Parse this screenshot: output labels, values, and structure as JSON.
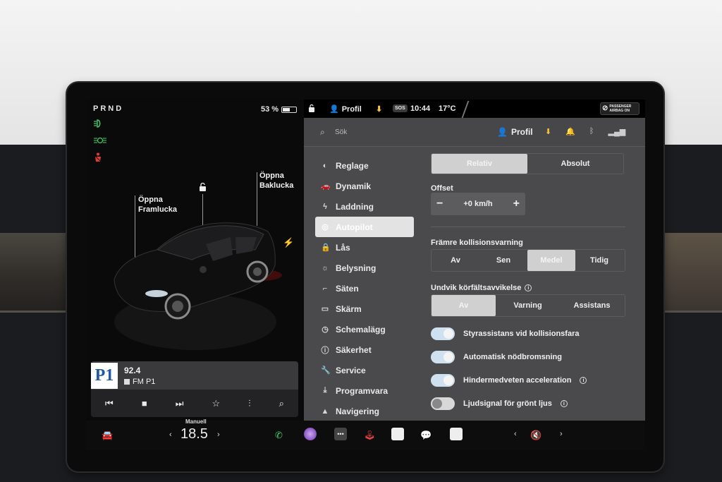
{
  "status": {
    "gear": "PRND",
    "battery_pct": "53 %",
    "battery_level": 0.53,
    "profile": "Profil",
    "time": "10:44",
    "temperature": "17°C",
    "sos": "SOS",
    "airbag_line1": "PASSENGER",
    "airbag_line2": "AIRBAG ON"
  },
  "car": {
    "front_trunk_line1": "Öppna",
    "front_trunk_line2": "Framlucka",
    "rear_trunk_line1": "Öppna",
    "rear_trunk_line2": "Baklucka"
  },
  "media": {
    "logo": "P1",
    "frequency": "92.4",
    "source": "FM P1"
  },
  "settings_header": {
    "search_placeholder": "Sök",
    "profile": "Profil"
  },
  "menu": [
    {
      "label": "Reglage",
      "icon": "toggle-icon"
    },
    {
      "label": "Dynamik",
      "icon": "car-icon"
    },
    {
      "label": "Laddning",
      "icon": "bolt-icon"
    },
    {
      "label": "Autopilot",
      "icon": "steering-wheel-icon",
      "active": true
    },
    {
      "label": "Lås",
      "icon": "lock-icon"
    },
    {
      "label": "Belysning",
      "icon": "sun-icon"
    },
    {
      "label": "Säten",
      "icon": "seat-icon"
    },
    {
      "label": "Skärm",
      "icon": "display-icon"
    },
    {
      "label": "Schemalägg",
      "icon": "clock-icon"
    },
    {
      "label": "Säkerhet",
      "icon": "info-icon"
    },
    {
      "label": "Service",
      "icon": "wrench-icon"
    },
    {
      "label": "Programvara",
      "icon": "download-icon"
    },
    {
      "label": "Navigering",
      "icon": "navigation-icon"
    }
  ],
  "autopilot": {
    "speed_mode": {
      "options": [
        "Relativ",
        "Absolut"
      ],
      "selected": "Relativ"
    },
    "offset_label": "Offset",
    "offset_value": "+0 km/h",
    "minus": "−",
    "plus": "+",
    "fcw_label": "Främre kollisionsvarning",
    "fcw": {
      "options": [
        "Av",
        "Sen",
        "Medel",
        "Tidig"
      ],
      "selected": "Medel"
    },
    "lane_label": "Undvik körfältsavvikelse",
    "lane": {
      "options": [
        "Av",
        "Varning",
        "Assistans"
      ],
      "selected": "Av"
    },
    "toggles": [
      {
        "label": "Styrassistans vid kollisionsfara",
        "on": true
      },
      {
        "label": "Automatisk nödbromsning",
        "on": true
      },
      {
        "label": "Hindermedveten acceleration",
        "on": true,
        "info": true
      },
      {
        "label": "Ljudsignal för grönt ljus",
        "on": false,
        "info": true
      }
    ]
  },
  "bottom": {
    "climate_mode": "Manuell",
    "cabin_temp": "18.5",
    "volume_icon": "mute-icon"
  }
}
